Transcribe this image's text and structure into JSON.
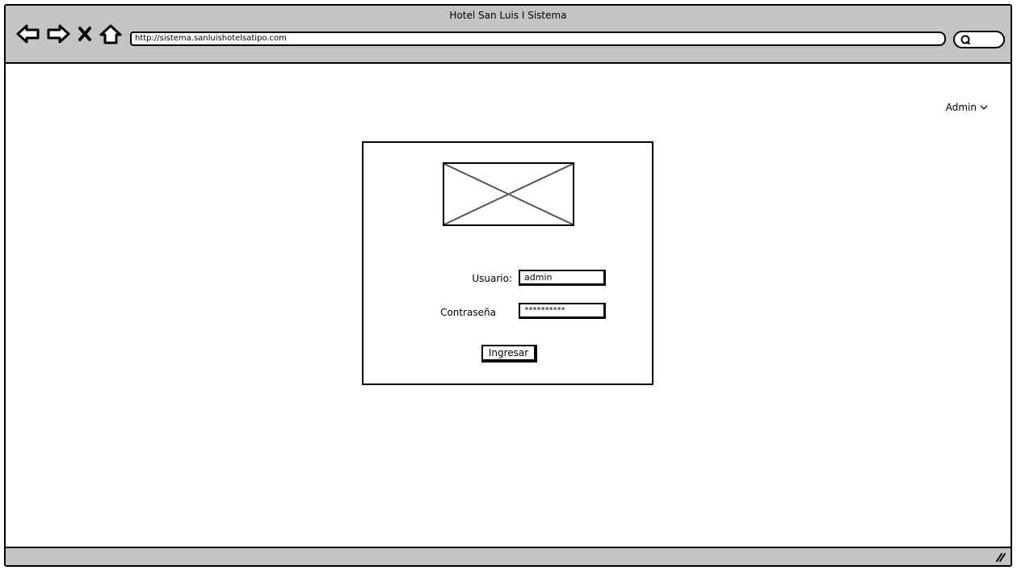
{
  "window": {
    "title": "Hotel San Luis I Sistema"
  },
  "browser": {
    "url": "http://sistema.sanluishotelsatipo.com",
    "icons": [
      "back-arrow-icon",
      "forward-arrow-icon",
      "stop-icon",
      "home-icon",
      "search-icon",
      "resize-grip-icon"
    ]
  },
  "header": {
    "user_menu_label": "Admin"
  },
  "login": {
    "logo": "image-placeholder",
    "username_label": "Usuario:",
    "username_value": "admin",
    "password_label": "Contraseña",
    "password_value": "**********",
    "submit_label": "Ingresar"
  }
}
